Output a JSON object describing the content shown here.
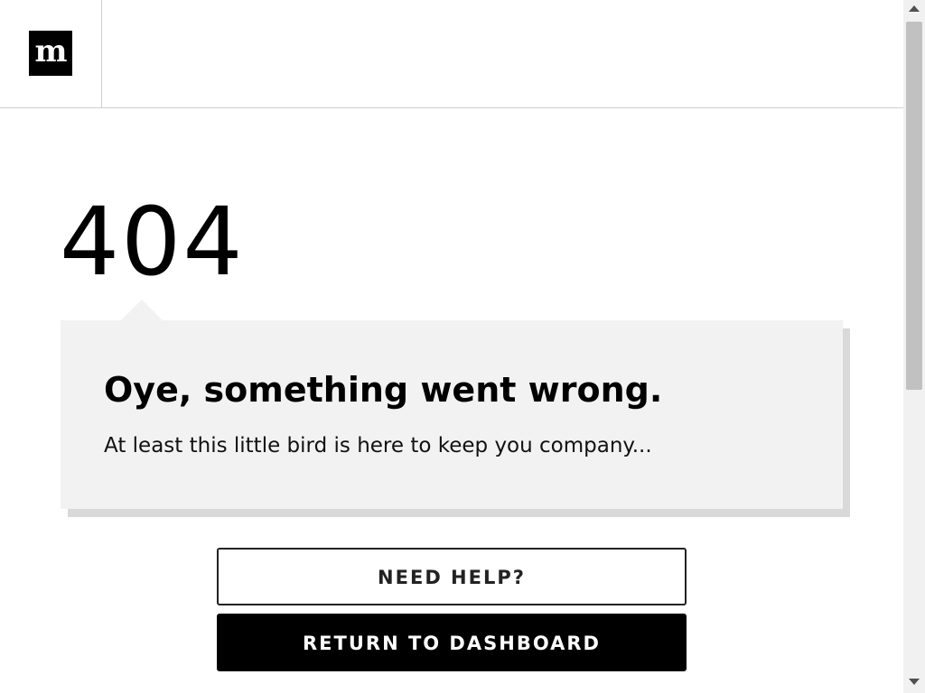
{
  "header": {
    "logo_text": "m",
    "logo_icon": "brand-logo-icon"
  },
  "error": {
    "code": "404",
    "title": "Oye, something went wrong.",
    "message": "At least this little bird is here to keep you company..."
  },
  "actions": {
    "help_label": "NEED HELP?",
    "dashboard_label": "RETURN TO DASHBOARD"
  },
  "scrollbar": {
    "position": 0.0
  },
  "colors": {
    "card_background": "#f2f2f2",
    "primary_button": "#000000"
  }
}
